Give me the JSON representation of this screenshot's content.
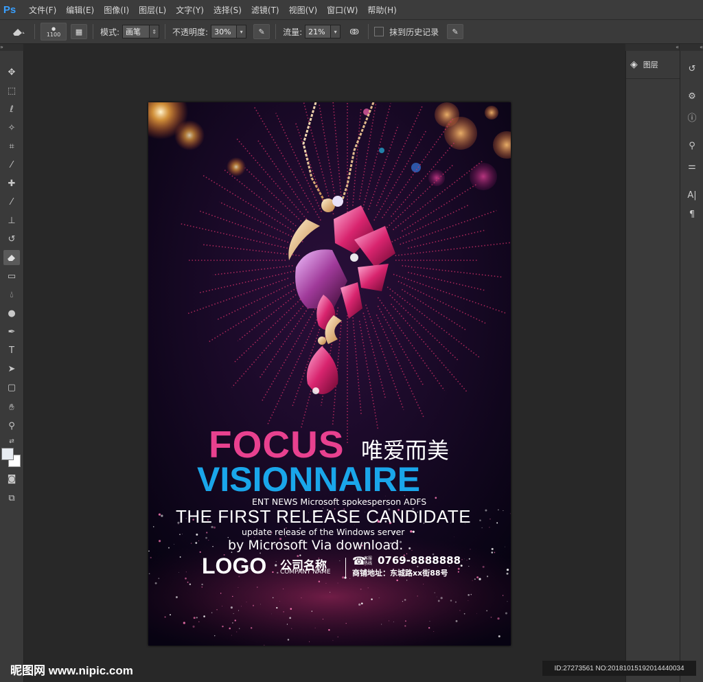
{
  "app": {
    "logo": "Ps",
    "menu": [
      "文件(F)",
      "编辑(E)",
      "图像(I)",
      "图层(L)",
      "文字(Y)",
      "选择(S)",
      "滤镜(T)",
      "视图(V)",
      "窗口(W)",
      "帮助(H)"
    ]
  },
  "options": {
    "brush_size": "1100",
    "mode_label": "模式:",
    "mode_value": "画笔",
    "opacity_label": "不透明度:",
    "opacity_value": "30%",
    "flow_label": "流量:",
    "flow_value": "21%",
    "history_label": "抹到历史记录"
  },
  "panels": {
    "layers_label": "图层"
  },
  "poster": {
    "focus": "FOCUS",
    "chinese_title": "唯爱而美",
    "visionnaire": "VISIONNAIRE",
    "ent_news": "ENT NEWS Microsoft spokesperson ADFS",
    "release": "THE FIRST RELEASE CANDIDATE",
    "update": "update release of the Windows server",
    "by_microsoft": "by Microsoft Via download.",
    "logo": "LOGO",
    "company_cn": "公司名称",
    "company_en": "COMPANY NAME",
    "phone_label": "客服热线",
    "phone": "0769-8888888",
    "address": "商铺地址：东城路xx街88号",
    "colors": {
      "focus": "#e8418f",
      "visionnaire": "#1aa6ea",
      "background": "#0a0418"
    }
  },
  "watermark": {
    "site": "昵图网 www.nipic.com",
    "id": "ID:27273561 NO:20181015192014440034"
  }
}
